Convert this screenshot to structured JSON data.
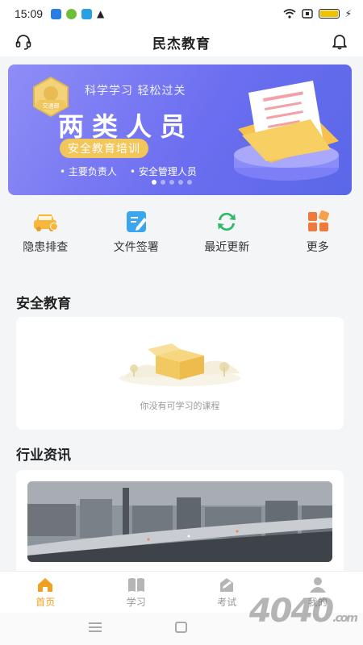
{
  "status_bar": {
    "time": "15:09"
  },
  "header": {
    "title": "民杰教育"
  },
  "banner": {
    "badge_text": "交通部",
    "subtitle": "科学学习 轻松过关",
    "headline": "两类人员",
    "pill": "安全教育培训",
    "items": [
      "主要负责人",
      "安全管理人员"
    ]
  },
  "quick_actions": [
    {
      "label": "隐患排查",
      "icon": "car-icon"
    },
    {
      "label": "文件签署",
      "icon": "edit-doc-icon"
    },
    {
      "label": "最近更新",
      "icon": "refresh-icon"
    },
    {
      "label": "更多",
      "icon": "grid-icon"
    }
  ],
  "safety_section": {
    "title": "安全教育",
    "empty_text": "你没有可学习的课程"
  },
  "news_section": {
    "title": "行业资讯"
  },
  "tabs": [
    {
      "label": "首页",
      "icon": "home-icon"
    },
    {
      "label": "学习",
      "icon": "book-icon"
    },
    {
      "label": "考试",
      "icon": "exam-icon"
    },
    {
      "label": "我的",
      "icon": "user-icon"
    }
  ],
  "watermark": {
    "main": "4040",
    "suffix": ".com"
  },
  "colors": {
    "accent": "#f0a020",
    "banner": "#6b6ef0"
  }
}
